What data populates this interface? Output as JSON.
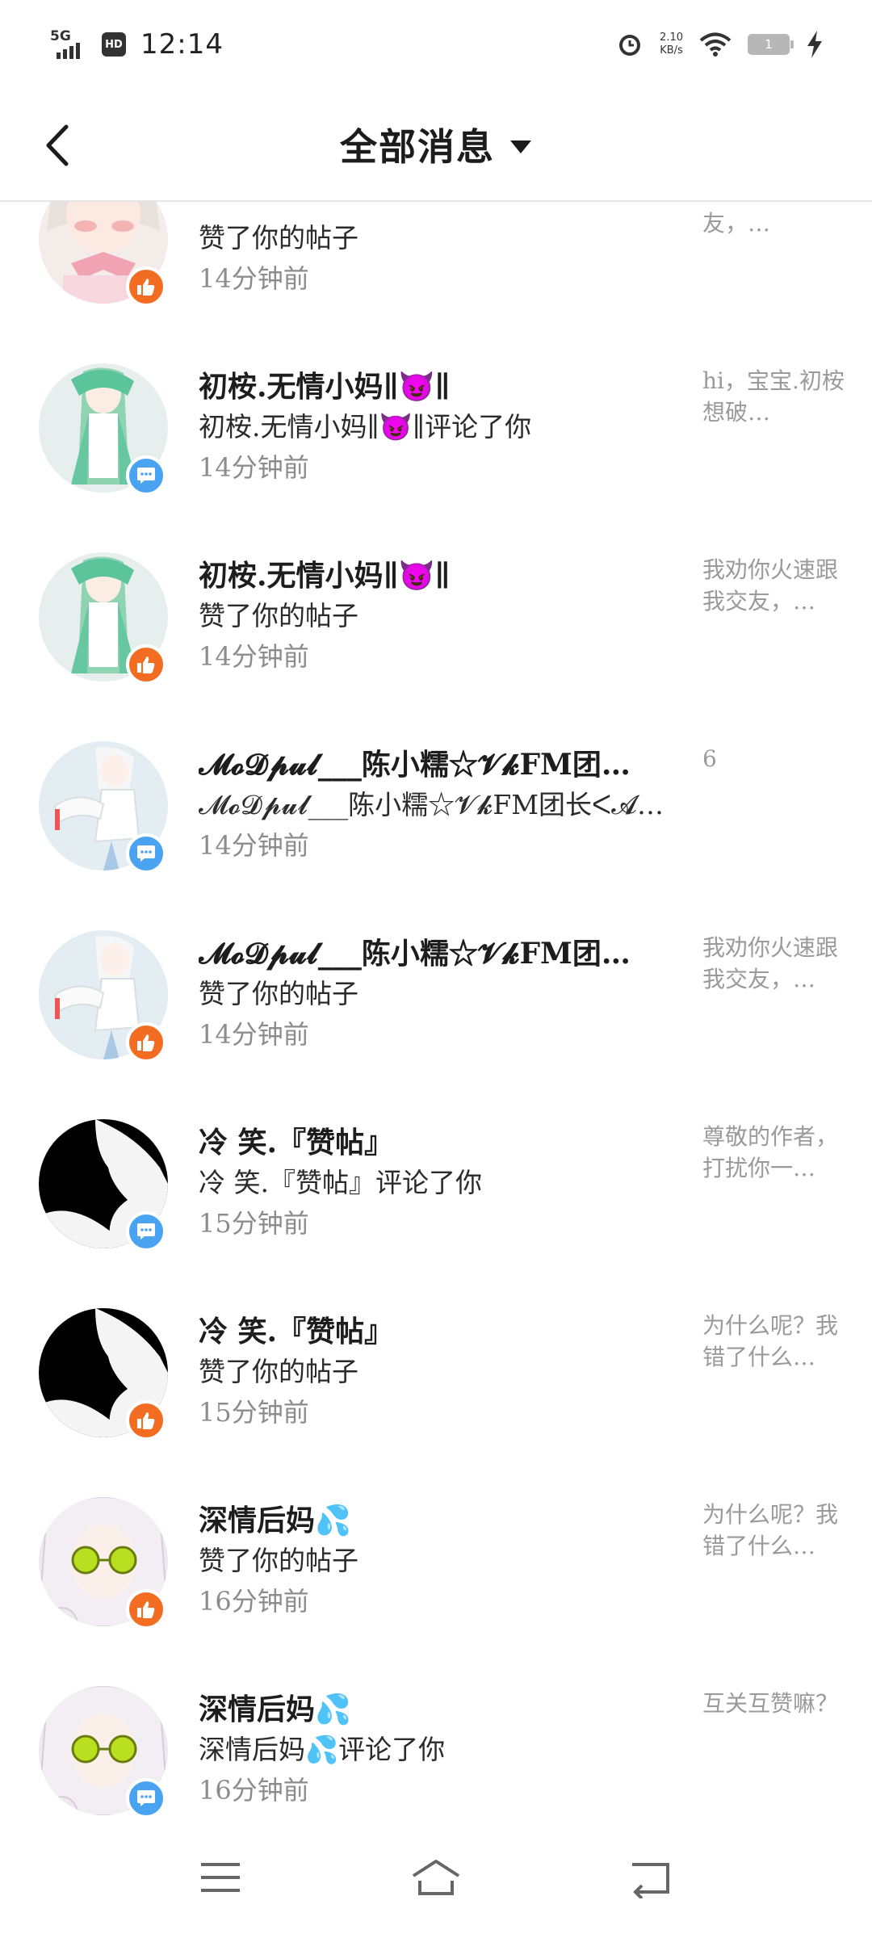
{
  "status_bar": {
    "network": "5G",
    "hd": "HD",
    "time": "12:14",
    "net_speed_value": "2.10",
    "net_speed_unit": "KB/s",
    "battery": "1",
    "icons": [
      "signal-icon",
      "alarm-icon",
      "wifi-icon",
      "battery-icon",
      "charging-bolt-icon"
    ]
  },
  "header": {
    "back_icon": "chevron-left-icon",
    "title": "全部消息",
    "dropdown_icon": "caret-down-icon"
  },
  "messages": [
    {
      "name": "",
      "action": "赞了你的帖子",
      "time": "14分钟前",
      "preview": "速跟我交友，…",
      "type": "like",
      "avatar": "anime-girl-pink-bow"
    },
    {
      "name": "初桉.无情小妈∥😈∥",
      "action": "初桉.无情小妈∥😈∥评论了你",
      "time": "14分钟前",
      "preview": "hi，宝宝.初桉想破…",
      "type": "comment",
      "avatar": "anime-green-hair"
    },
    {
      "name": "初桉.无情小妈∥😈∥",
      "action": "赞了你的帖子",
      "time": "14分钟前",
      "preview": "我劝你火速跟我交友，…",
      "type": "like",
      "avatar": "anime-green-hair"
    },
    {
      "name": "𝓜𝓸𝓓𝓹𝓾𝓵___陈小糯☆𝓥𝓴FM团…",
      "action": "𝓜𝓸𝓓𝓹𝓾𝓵___陈小糯☆𝓥𝓴FM团长ᐸ𝓐𝓯…",
      "time": "14分钟前",
      "preview": "6",
      "type": "comment",
      "avatar": "anime-white-hair"
    },
    {
      "name": "𝓜𝓸𝓓𝓹𝓾𝓵___陈小糯☆𝓥𝓴FM团…",
      "action": "赞了你的帖子",
      "time": "14分钟前",
      "preview": "我劝你火速跟我交友，…",
      "type": "like",
      "avatar": "anime-white-hair"
    },
    {
      "name": "冷 笑.『赞帖』",
      "action": "冷 笑.『赞帖』评论了你",
      "time": "15分钟前",
      "preview": "尊敬的作者，打扰你一…",
      "type": "comment",
      "avatar": "black-silhouette"
    },
    {
      "name": "冷 笑.『赞帖』",
      "action": "赞了你的帖子",
      "time": "15分钟前",
      "preview": "为什么呢？我错了什么…",
      "type": "like",
      "avatar": "black-silhouette"
    },
    {
      "name": "深情后妈💦",
      "action": "赞了你的帖子",
      "time": "16分钟前",
      "preview": "为什么呢？我错了什么…",
      "type": "like",
      "avatar": "anime-white-hair-sunglasses"
    },
    {
      "name": "深情后妈💦",
      "action": "深情后妈💦评论了你",
      "time": "16分钟前",
      "preview": "互关互赞嘛？",
      "type": "comment",
      "avatar": "anime-white-hair-sunglasses"
    }
  ],
  "nav_bar": {
    "icons": [
      "menu-icon",
      "home-icon",
      "back-icon"
    ]
  },
  "colors": {
    "like_badge": "#f26d22",
    "comment_badge": "#4aa3f0",
    "time_text": "#8c8c8c",
    "preview_text": "#9a9a9a"
  }
}
